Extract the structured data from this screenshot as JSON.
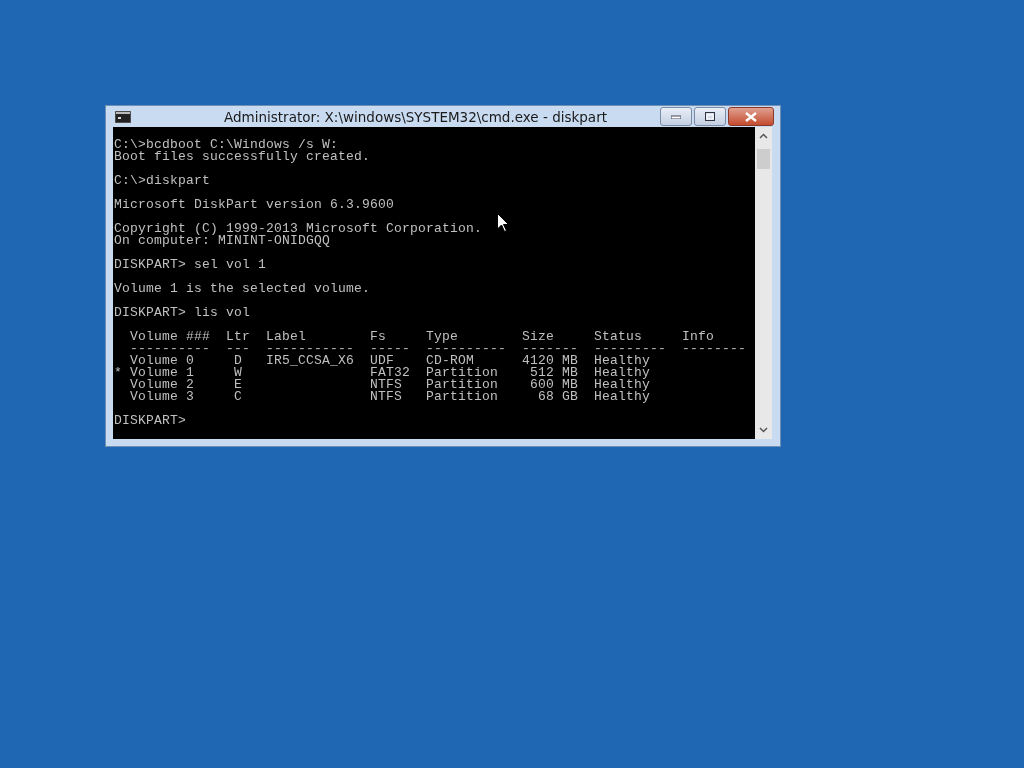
{
  "window": {
    "title": "Administrator: X:\\windows\\SYSTEM32\\cmd.exe - diskpart"
  },
  "console": {
    "blocks": [
      [
        "C:\\>bcdboot C:\\Windows /s W:",
        "Boot files successfully created."
      ],
      [
        "C:\\>diskpart"
      ],
      [
        "Microsoft DiskPart version 6.3.9600"
      ],
      [
        "Copyright (C) 1999-2013 Microsoft Corporation.",
        "On computer: MININT-ONIDGQQ"
      ],
      [
        "DISKPART> sel vol 1"
      ],
      [
        "Volume 1 is the selected volume."
      ],
      [
        "DISKPART> lis vol"
      ],
      [
        "  Volume ###  Ltr  Label        Fs     Type        Size     Status     Info",
        "  ----------  ---  -----------  -----  ----------  -------  ---------  --------",
        "  Volume 0     D   IR5_CCSA_X6  UDF    CD-ROM      4120 MB  Healthy",
        "* Volume 1     W                FAT32  Partition    512 MB  Healthy",
        "  Volume 2     E                NTFS   Partition    600 MB  Healthy",
        "  Volume 3     C                NTFS   Partition     68 GB  Healthy"
      ],
      [
        "DISKPART>"
      ]
    ]
  }
}
